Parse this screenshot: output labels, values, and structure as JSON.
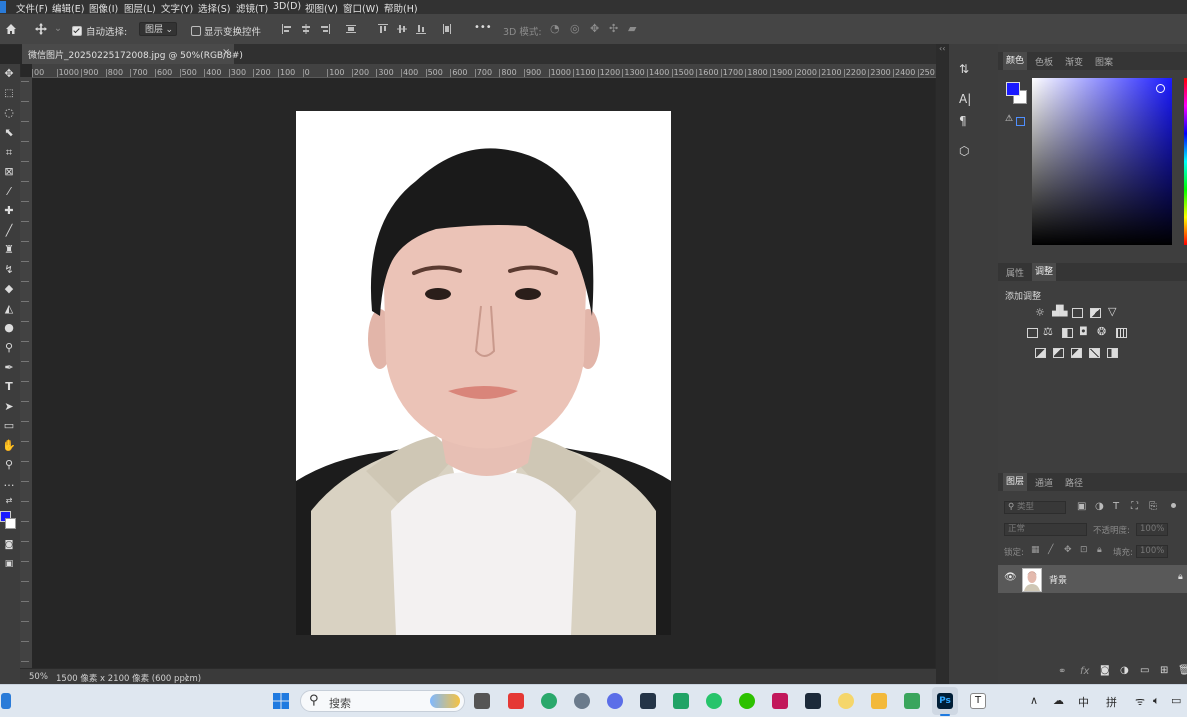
{
  "menu": [
    "文件(F)",
    "编辑(E)",
    "图像(I)",
    "图层(L)",
    "文字(Y)",
    "选择(S)",
    "滤镜(T)",
    "3D(D)",
    "视图(V)",
    "窗口(W)",
    "帮助(H)"
  ],
  "options_bar": {
    "auto_select_label": "自动选择:",
    "auto_select_value": "图层",
    "show_transform_label": "显示变换控件",
    "more": "•••",
    "mode_3d_label": "3D 模式:"
  },
  "document_tab": {
    "title": "微信图片_20250225172008.jpg @ 50%(RGB/8#)",
    "close": "×"
  },
  "ruler_labels": [
    "00",
    "1000",
    "900",
    "800",
    "700",
    "600",
    "500",
    "400",
    "300",
    "200",
    "100",
    "0",
    "100",
    "200",
    "300",
    "400",
    "500",
    "600",
    "700",
    "800",
    "900",
    "1000",
    "1100",
    "1200",
    "1300",
    "1400",
    "1500",
    "1600",
    "1700",
    "1800",
    "1900",
    "2000",
    "2100",
    "2200",
    "2300",
    "2400",
    "250"
  ],
  "status_bar": {
    "zoom": "50%",
    "doc_info": "1500 像素 x 2100 像素 (600 ppcm)",
    "arrow": "〉"
  },
  "color_panel": {
    "tabs": [
      "颜色",
      "色板",
      "渐变",
      "图案"
    ],
    "foreground_color": "#1a1aff",
    "background_color": "#ffffff"
  },
  "adjustments_panel": {
    "tabs": [
      "属性",
      "调整"
    ],
    "heading": "添加调整"
  },
  "layers_panel": {
    "tabs": [
      "图层",
      "通道",
      "路径"
    ],
    "search_placeholder": "类型",
    "blend_mode": "正常",
    "opacity_label": "不透明度:",
    "opacity_value": "100%",
    "lock_label": "锁定:",
    "fill_label": "填充:",
    "fill_value": "100%",
    "layers": [
      {
        "name": "背景"
      }
    ]
  },
  "taskbar": {
    "search_label": "搜索",
    "ime_lang": "中",
    "ime_mode": "拼"
  },
  "colors": {
    "app_bg": "#282828",
    "panel_bg": "#3e3e3e",
    "photoshop_blue": "#2a7bd8"
  }
}
